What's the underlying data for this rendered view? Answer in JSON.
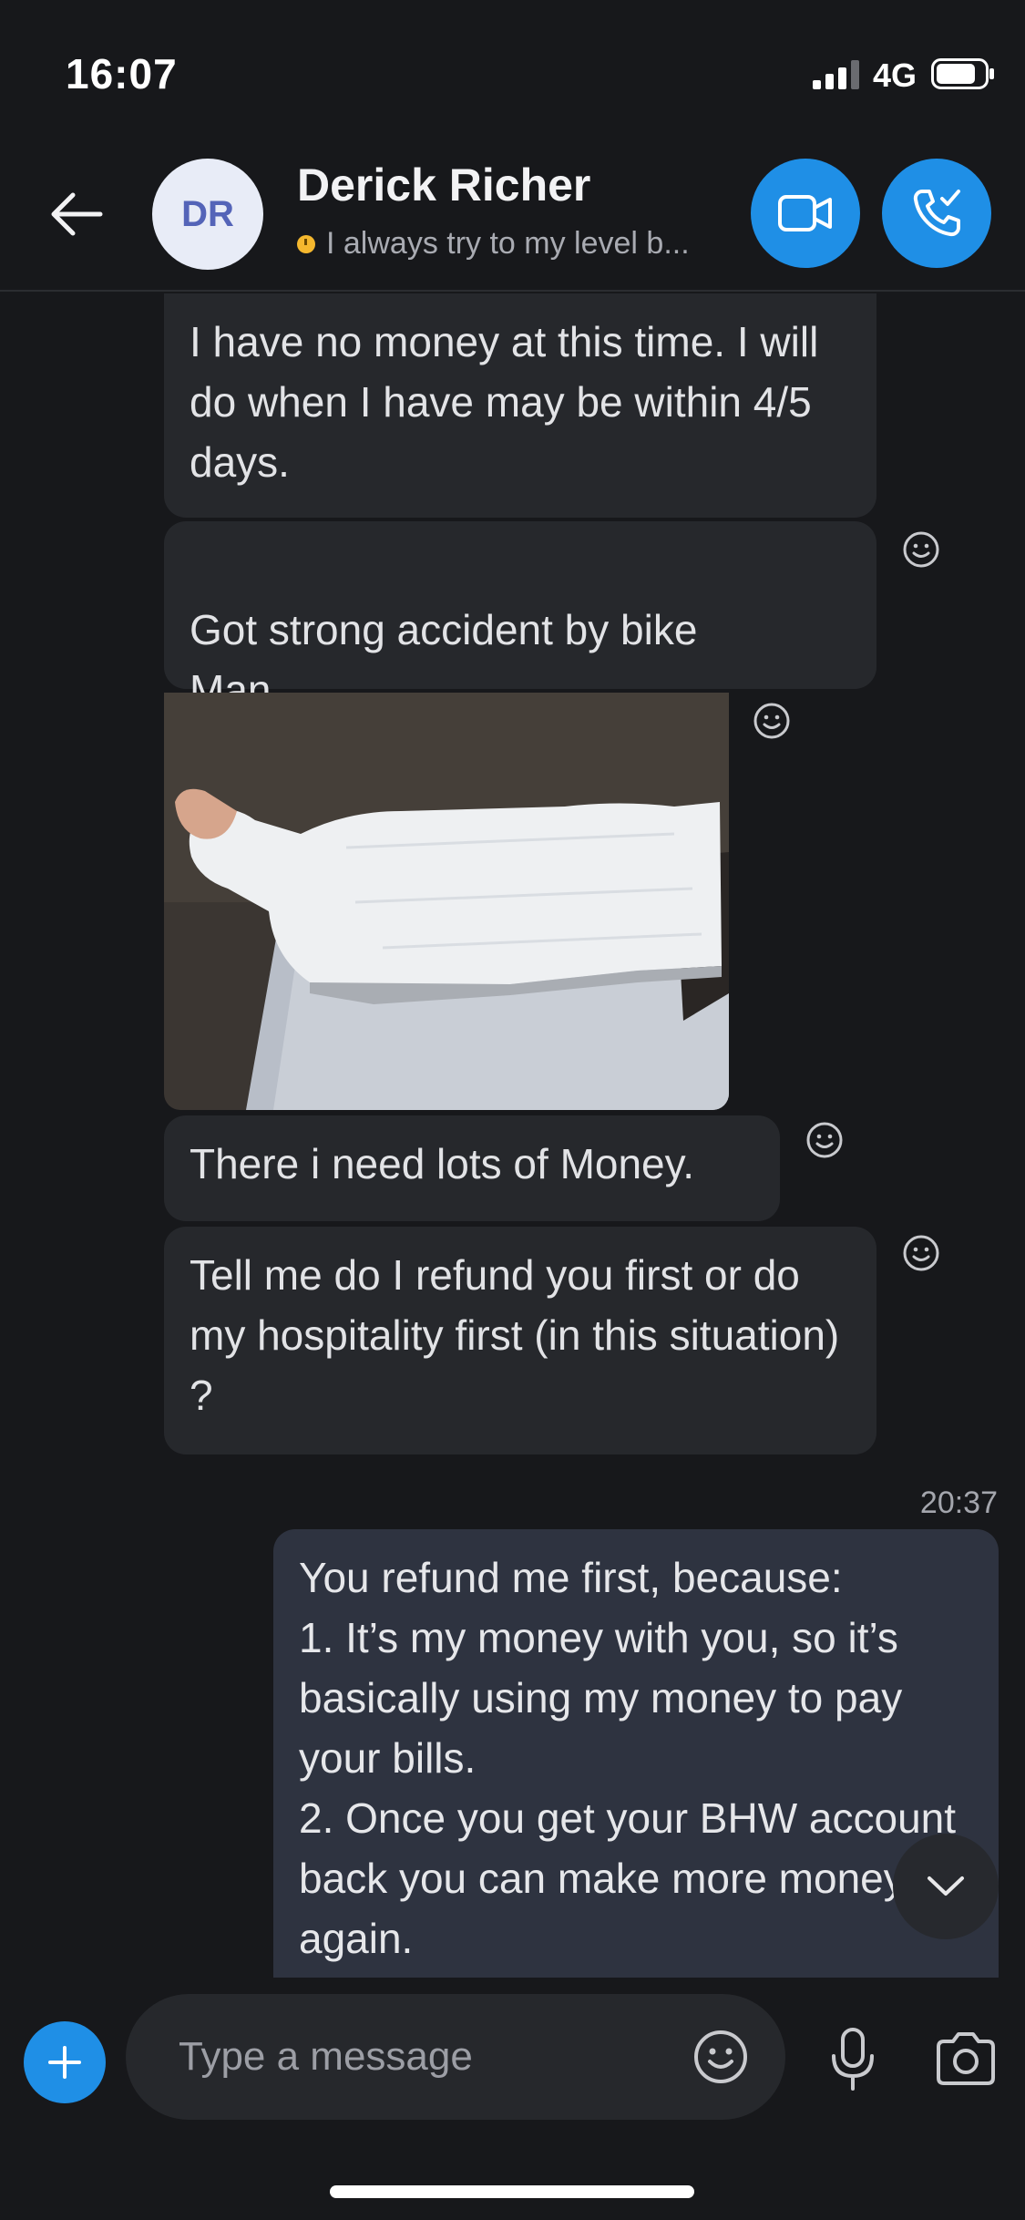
{
  "status_bar": {
    "time": "16:07",
    "network": "4G"
  },
  "header": {
    "avatar_initials": "DR",
    "contact_name": "Derick Richer",
    "mood_message": "I always try to my level b..."
  },
  "messages": [
    {
      "direction": "incoming",
      "text": "I have no money at this time. I will do when I have may be within 4/5 days."
    },
    {
      "direction": "incoming",
      "text": "Got strong accident by bike\nMan"
    },
    {
      "direction": "incoming",
      "type": "photo",
      "icon": "leg-cast-photo"
    },
    {
      "direction": "incoming",
      "text": "There i need lots of Money."
    },
    {
      "direction": "incoming",
      "text": "Tell me do I refund you first or do my hospitality first (in this situation) ?"
    }
  ],
  "timestamp": "20:37",
  "outgoing": {
    "lines": [
      "You refund me first, because:",
      "1. It’s my money with you, so it’s basically using my money to pay your bills.",
      "2. Once you get your BHW account back you can make more money again."
    ]
  },
  "composer": {
    "placeholder": "Type a message"
  },
  "colors": {
    "accent": "#1f8fe6",
    "background": "#17181b",
    "incoming_bubble": "#26282c",
    "outgoing_bubble": "#2e3340"
  }
}
